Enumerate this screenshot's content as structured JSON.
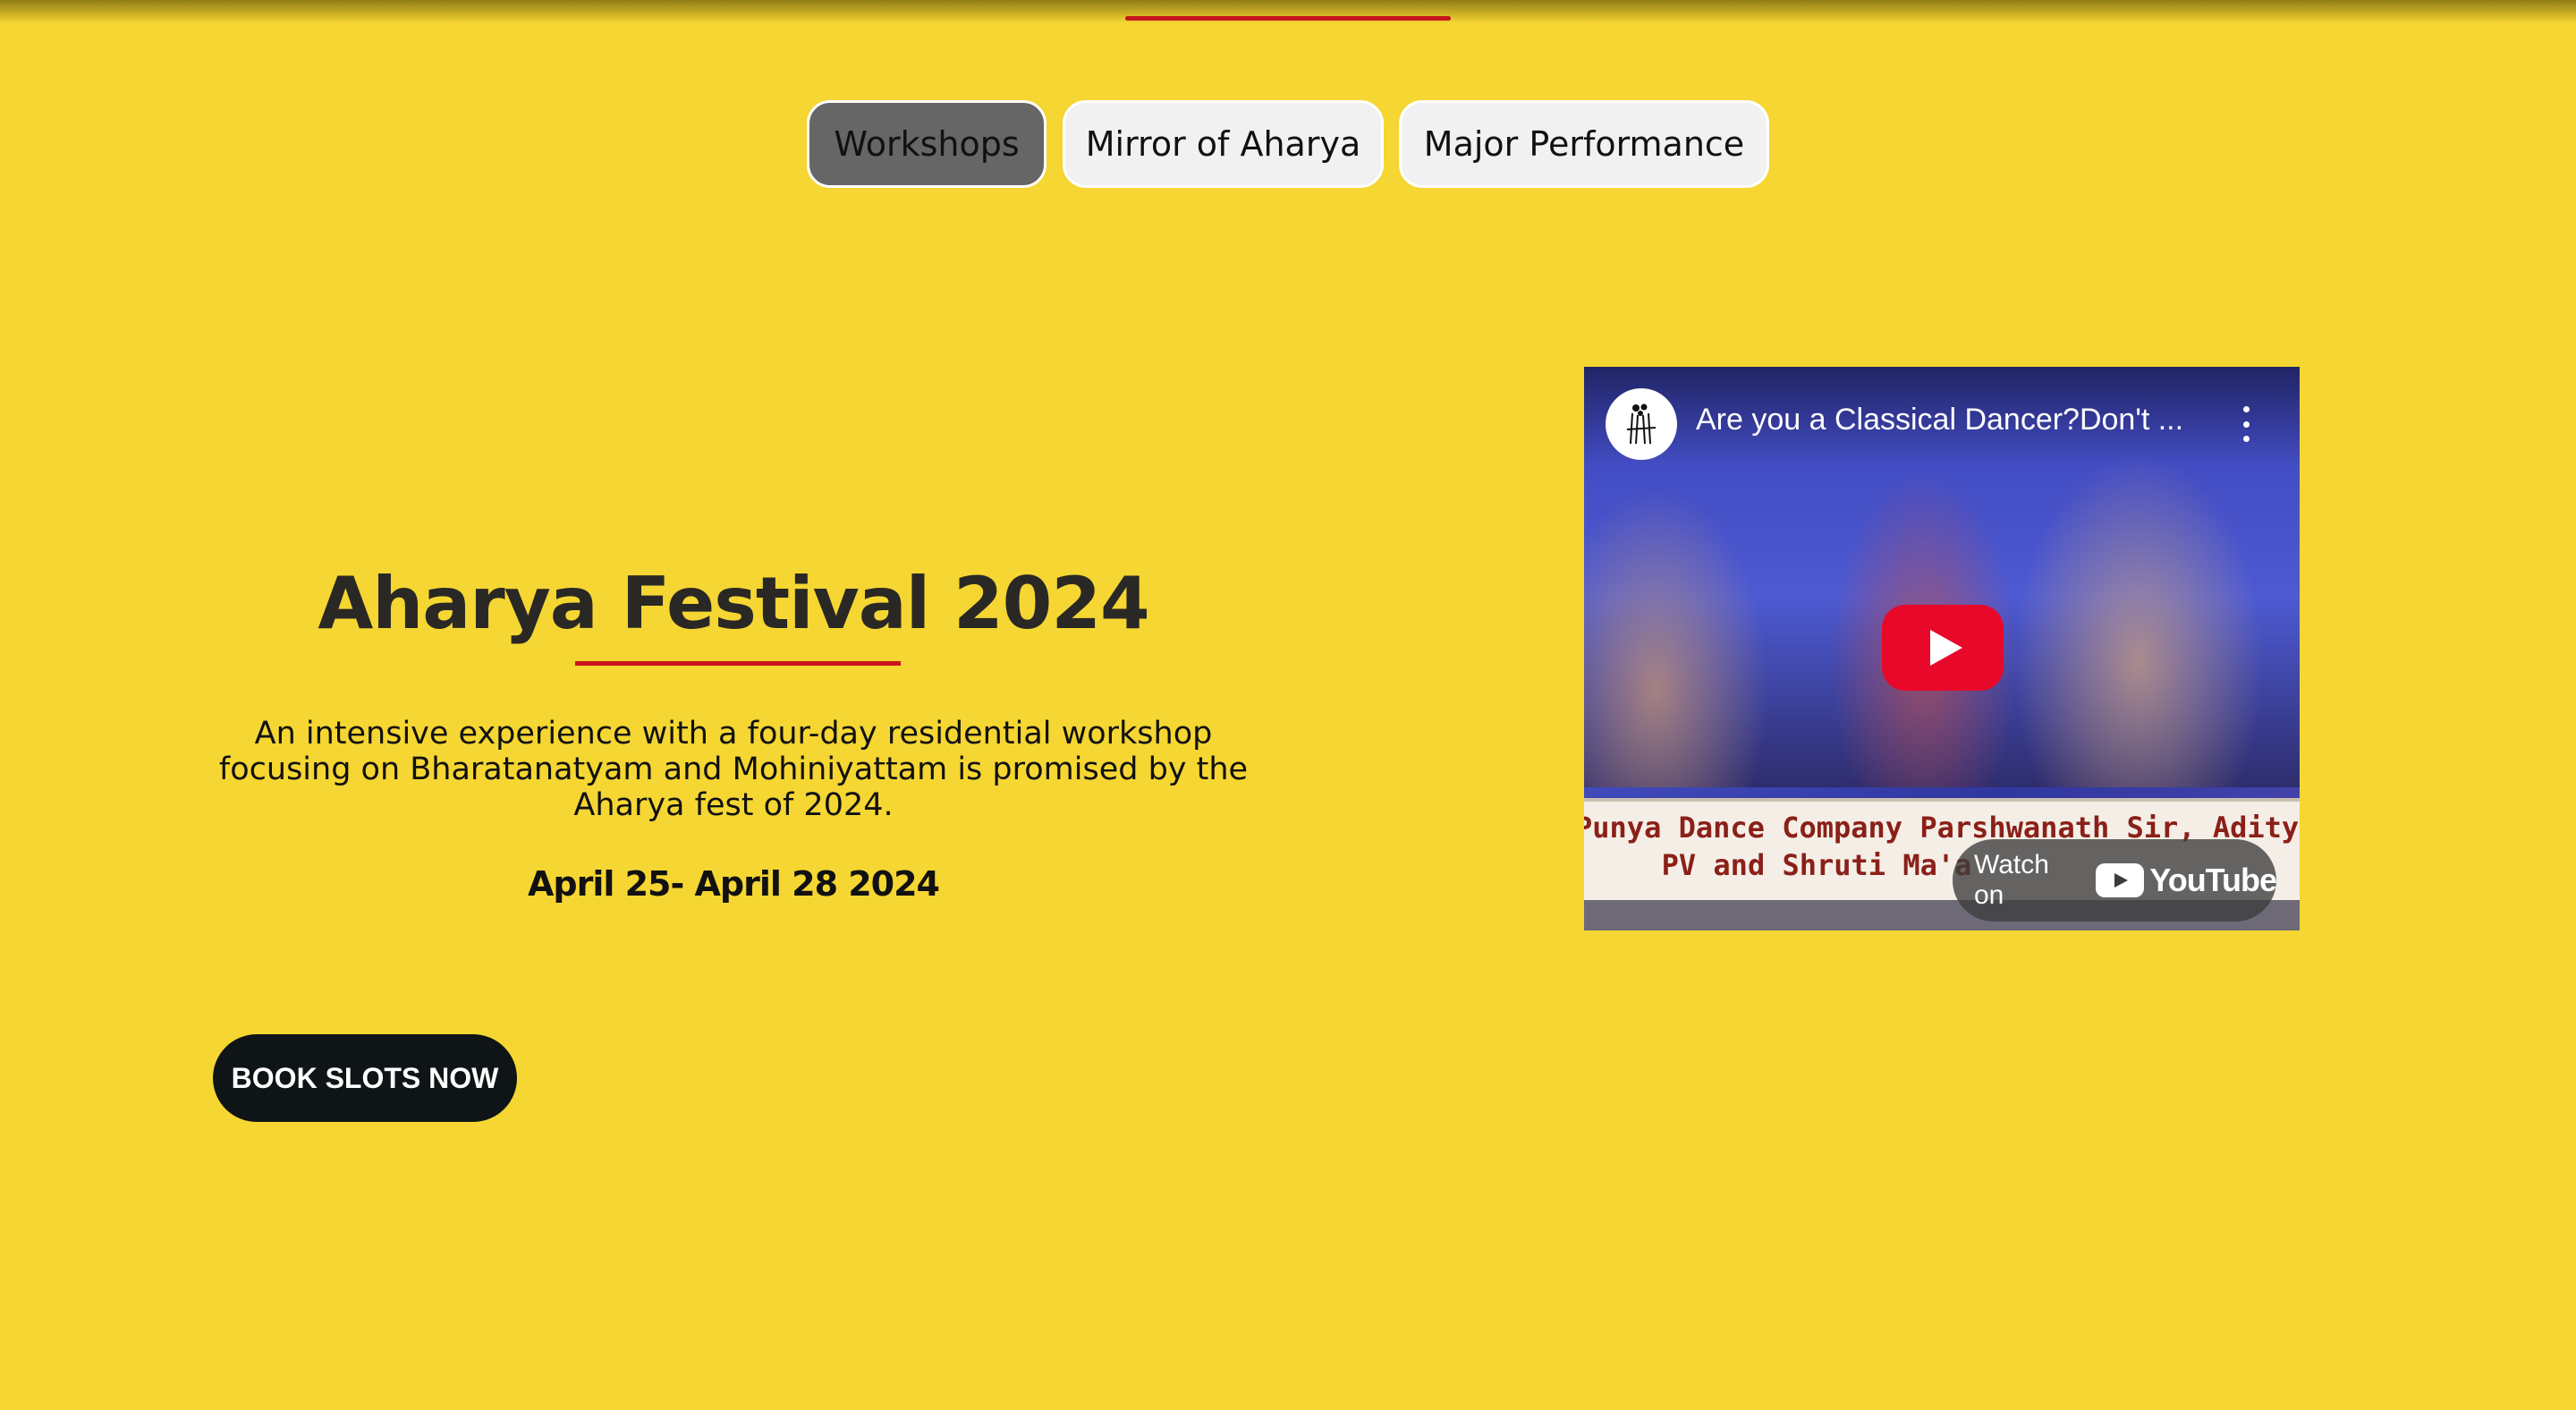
{
  "tabs": [
    {
      "label": "Workshops",
      "active": true
    },
    {
      "label": "Mirror of Aharya",
      "active": false
    },
    {
      "label": "Major Performance",
      "active": false
    }
  ],
  "hero": {
    "title": "Aharya Festival 2024",
    "description": "An intensive experience with a four-day residential workshop focusing on Bharatanatyam and Mohiniyattam is promised by the Aharya fest of 2024.",
    "dates": "April 25- April 28 2024",
    "cta_label": "BOOK SLOTS NOW"
  },
  "video": {
    "title": "Are you a Classical Dancer?Don't ...",
    "caption_line1": "Punya Dance Company Parshwanath Sir, Adity",
    "caption_line2": "PV and Shruti Ma'a",
    "watch_on_label": "Watch on",
    "platform_name": "YouTube",
    "channel_icon": "channel-logo-icon",
    "play_icon": "play-icon",
    "menu_icon": "more-vert-icon"
  },
  "colors": {
    "background": "#f5d632",
    "accent": "#c7161b",
    "active_tab": "#666666",
    "inactive_tab": "#f1f1f1",
    "cta_background": "#0f1516"
  }
}
